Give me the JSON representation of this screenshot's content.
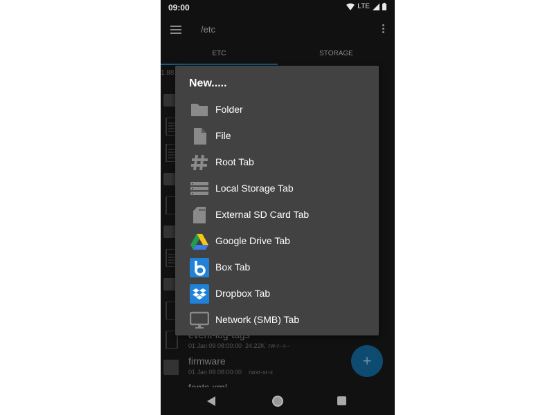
{
  "status_bar": {
    "time": "09:00",
    "network": "LTE"
  },
  "app_bar": {
    "path": "/etc"
  },
  "tabs": [
    {
      "label": "ETC",
      "active": true
    },
    {
      "label": "STORAGE",
      "active": false
    }
  ],
  "file_list": {
    "size_hint": "1.88",
    "rows": [
      {
        "name": "event-log-tags",
        "date": "01 Jan 09 08:00:00",
        "size": "24.22K",
        "perms": "rw-r--r--",
        "type": "file"
      },
      {
        "name": "firmware",
        "date": "01 Jan 09 08:00:00",
        "size": "",
        "perms": "rwxr-xr-x",
        "type": "folder"
      },
      {
        "name": "fonts.xml",
        "date": "",
        "size": "",
        "perms": "",
        "type": "file"
      }
    ]
  },
  "dialog": {
    "title": "New.....",
    "items": [
      {
        "label": "Folder",
        "icon": "folder-icon"
      },
      {
        "label": "File",
        "icon": "file-icon"
      },
      {
        "label": "Root Tab",
        "icon": "hash-icon"
      },
      {
        "label": "Local Storage Tab",
        "icon": "storage-icon"
      },
      {
        "label": "External SD Card Tab",
        "icon": "sd-card-icon"
      },
      {
        "label": "Google Drive Tab",
        "icon": "google-drive-icon"
      },
      {
        "label": "Box Tab",
        "icon": "box-icon"
      },
      {
        "label": "Dropbox Tab",
        "icon": "dropbox-icon"
      },
      {
        "label": "Network (SMB) Tab",
        "icon": "monitor-icon"
      }
    ]
  },
  "fab": {
    "label": "+"
  },
  "colors": {
    "accent": "#1a5a80",
    "dialog_bg": "#424242",
    "fab": "#0d4b70"
  }
}
